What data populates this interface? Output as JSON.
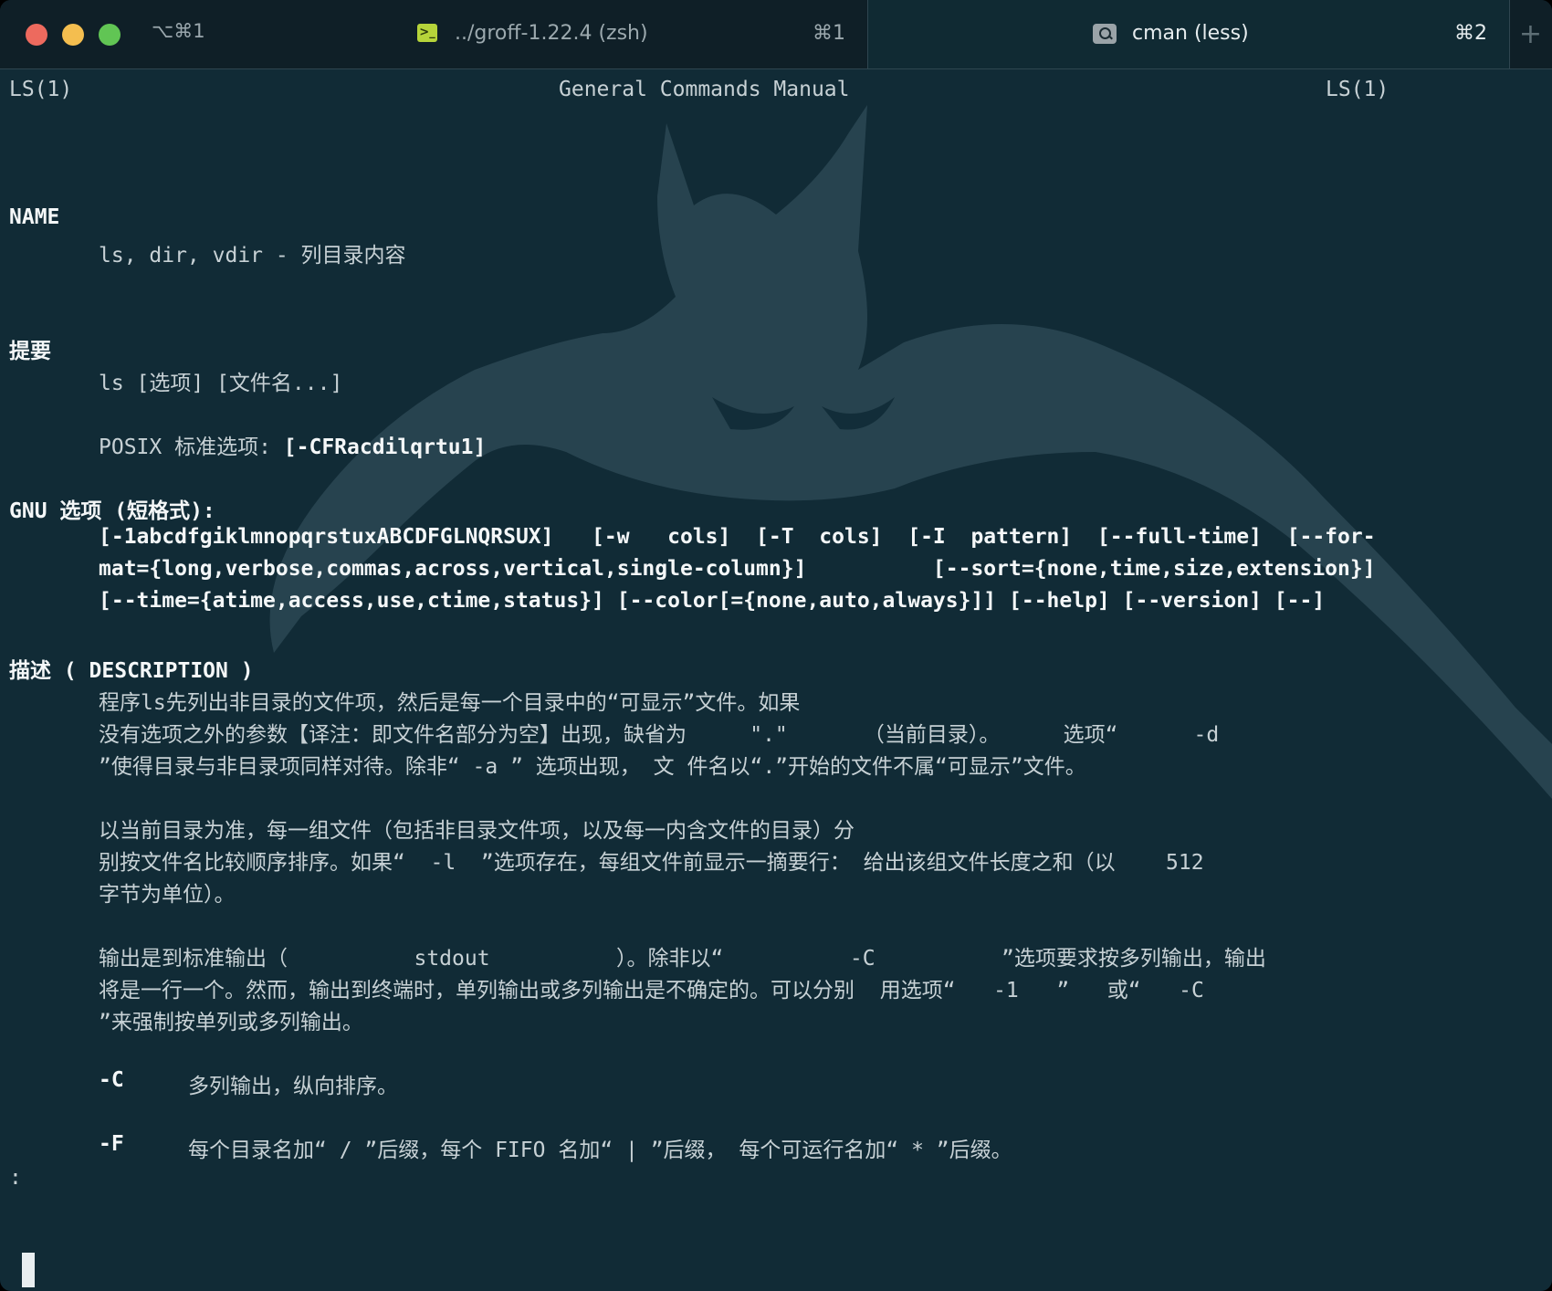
{
  "window": {
    "shortcut_left": "⌥⌘1",
    "tabs": [
      {
        "icon": "terminal-icon",
        "icon_glyph": ">_",
        "title": "../groff-1.22.4 (zsh)",
        "shortcut": "⌘1",
        "active": false
      },
      {
        "icon": "search-icon",
        "title": "cman (less)",
        "shortcut": "⌘2",
        "active": true
      }
    ],
    "new_tab_glyph": "+"
  },
  "colors": {
    "background": "#112b36",
    "text": "#c7d1d5",
    "bold_text": "#f4f7f8",
    "close": "#ed6a5e",
    "minimize": "#f4be4f",
    "maximize": "#61c554"
  },
  "background_image": "batman-silhouette",
  "man_page": {
    "header_left": "LS(1)",
    "header_center": "General Commands Manual",
    "header_right": "LS(1)",
    "name": {
      "heading": "NAME",
      "text": "ls, dir, vdir - 列目录内容"
    },
    "synopsis": {
      "heading": "提要",
      "usage": "ls [选项] [文件名...]",
      "posix_label": "POSIX 标准选项: ",
      "posix_options": "[-CFRacdilqrtu1]"
    },
    "gnu": {
      "heading": "GNU 选项 (短格式):",
      "lines": [
        "[-1abcdfgiklmnopqrstuxABCDFGLNQRSUX]   [-w   cols]  [-T  cols]  [-I  pattern]  [--full-time]  [--for-",
        "mat={long,verbose,commas,across,vertical,single-column}]          [--sort={none,time,size,extension}]",
        "[--time={atime,access,use,ctime,status}] [--color[={none,auto,always}]] [--help] [--version] [--]"
      ]
    },
    "description": {
      "heading": "描述 ( DESCRIPTION )",
      "paragraph1": [
        "程序ls先列出非目录的文件项，然后是每一个目录中的“可显示”文件。如果",
        "没有选项之外的参数【译注：即文件名部分为空】出现，缺省为     \".\"      （当前目录）。     选项“      -d",
        "”使得目录与非目录项同样对待。除非“ -a ” 选项出现， 文 件名以“.”开始的文件不属“可显示”文件。"
      ],
      "paragraph2": [
        "以当前目录为准，每一组文件（包括非目录文件项，以及每一内含文件的目录）分",
        "别按文件名比较顺序排序。如果“  -l  ”选项存在，每组文件前显示一摘要行： 给出该组文件长度之和（以    512",
        "字节为单位）。"
      ],
      "paragraph3": [
        "输出是到标准输出（          stdout          ）。除非以“          -C          ”选项要求按多列输出，输出",
        "将是一行一个。然而，输出到终端时，单列输出或多列输出是不确定的。可以分别  用选项“   -1   ”   或“   -C",
        "”来强制按单列或多列输出。"
      ],
      "options": [
        {
          "flag": "-C",
          "text": "多列输出，纵向排序。"
        },
        {
          "flag": "-F",
          "text": "每个目录名加“ / ”后缀，每个 FIFO 名加“ | ”后缀， 每个可运行名加“ * ”后缀。"
        }
      ]
    },
    "prompt": ":"
  }
}
